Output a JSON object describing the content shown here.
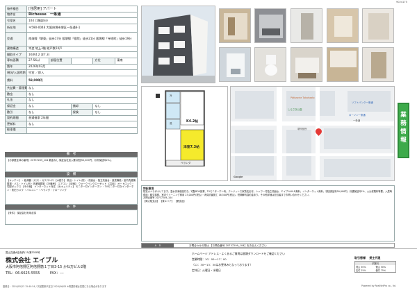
{
  "doc_id": "9024175",
  "header": {
    "type_label": "物件種目",
    "type_value": "[住居用] アパート"
  },
  "spec": [
    {
      "k": "物件名",
      "v": "Richesse　一条通"
    },
    {
      "k": "号室名",
      "v": "104 (1階部分)"
    },
    {
      "k": "所在地",
      "v": "〒590-0046 大阪府堺市堺区一条通8-1"
    },
    {
      "k": "交通",
      "v": "南海線「堺東」徒歩17分 阪堺線「宿院」徒歩21分 阪堺線「寺地町」徒歩19分"
    },
    {
      "k": "建物構造",
      "v": "木造 地上3階 総戸数24戸"
    },
    {
      "k": "間取タイプ",
      "v": "1K(K4.2 洋7.3)"
    },
    {
      "k": "専有面積",
      "v": "27.56㎡",
      "k2": "部屋位置",
      "v2": "",
      "k3": "方位",
      "v3": "東南"
    },
    {
      "k": "築年",
      "v": "2026年03月"
    },
    {
      "k": "現況/入居時期",
      "v": "空室 ／即入"
    },
    {
      "k": "賃料",
      "v": "58,000円"
    },
    {
      "k": "共益費・管理費",
      "v": "なし"
    },
    {
      "k": "敷金",
      "v": "なし"
    },
    {
      "k": "礼金",
      "v": "なし"
    },
    {
      "k": "保証金",
      "v": "なし",
      "k2": "償却",
      "v2": "なし"
    },
    {
      "k": "敷引",
      "v": "なし",
      "k2": "保険",
      "v2": "なし"
    },
    {
      "k": "契約期間",
      "v": "普通借家 2年間"
    },
    {
      "k": "更新料",
      "v": "なし"
    },
    {
      "k": "駐車場",
      "v": ""
    }
  ],
  "bikou": {
    "title": "備　考",
    "text": "【お部屋全体の番号】20737209_104 敷金なし 保証会社加入要(初回50,000円、月次保証料2%)。"
  },
  "setsubi": {
    "title": "設　備",
    "text": "【キッチン】 ：給湯器（ガス）・ガスコンロ 【水廻り】 風呂・トイレ(別) ・洗面台・独立洗面台・追焚機能・室内洗濯機置場・バス・トイレ別・洗濯機置場 【冷暖房】 エアコン 【收納】 ウォークインクローゼット 【共用】 オートロック・宅配ボックス 【その他】 インターネット対応 【セキュリティ】 モニター付インターホン ・TVモニター付きインターホン・防犯カメラ ・バルコニー・ベランダ・フローリング"
  },
  "jouken": {
    "title": "条　件",
    "text": "【条件】 保証会社利用必須"
  },
  "map": {
    "labels": [
      "Pâtisserie Takahaato",
      "ソフトバンク一条通",
      "ローソン一条通",
      "一条通",
      "堺市役所",
      "しらさぎ公園",
      "Google"
    ]
  },
  "floor": {
    "rooms": [
      "K4.2帖",
      "洋室7.3帖",
      "ベランダ",
      "冷",
      "洗"
    ]
  },
  "vtab": [
    "業",
    "務",
    "情",
    "報"
  ],
  "remarks": {
    "title": "特記事項",
    "text": "防犯カメラがついてます。温水洗浄便座付き。宅配BOX設置、TVモニターホン有。クレジットで家賃支払可。シャワー付独立洗面台、エイブルWi-Fi無料。インターネット無料。初回保証料50,000円、月額保証料2%、火災保険料等要。入居時費用：鍵交換費、室内クリーニング費用 23,000円(税込)・消臭抗菌施工 16,500円(税込)。短期解約違約金あり。その他詳細は担当者までお問い合わせください。",
    "contact": "お問合番号 20737209_104",
    "ad": "【周大阪支店】 【東エリア】 【業支店】"
  },
  "ad_bar": {
    "label": "A　D",
    "contact": "お問合わせの際は 【お問合番号 20737209_104】をお伝えください"
  },
  "footer": {
    "license": "国土交通大臣免許(15)第3338号",
    "company": "株式会社 エイブル",
    "address": "大阪市阿倍野区阿倍野筋１丁目3-15 かね万ビル2階",
    "tel": "TEL：06-6625-5555",
    "fax": "FAX：---",
    "msg": "ホームページ アドレス・よくあるご質問は書類ダウンロードをご確認ください",
    "hours1": "営業時間：10：00〜17：00",
    "hours2": "（12：30〜13：30はお昼休みとなっております）",
    "holiday": "定休日：火曜日・水曜日",
    "torihiki_title": "取引態様",
    "torihiki_value": "貸主代理",
    "fee_title": "手数料",
    "fee": [
      "貸主 50%",
      "借主 50%",
      "支付 25%",
      "借付 75%"
    ]
  },
  "bottom": {
    "left": "登録日：2024/05/23 15:40:54 / 次回更新予定日 2024/06/05 ※掲載情報は変更になる場合があります",
    "right": "Powered by RealNetPro co., ltd."
  }
}
